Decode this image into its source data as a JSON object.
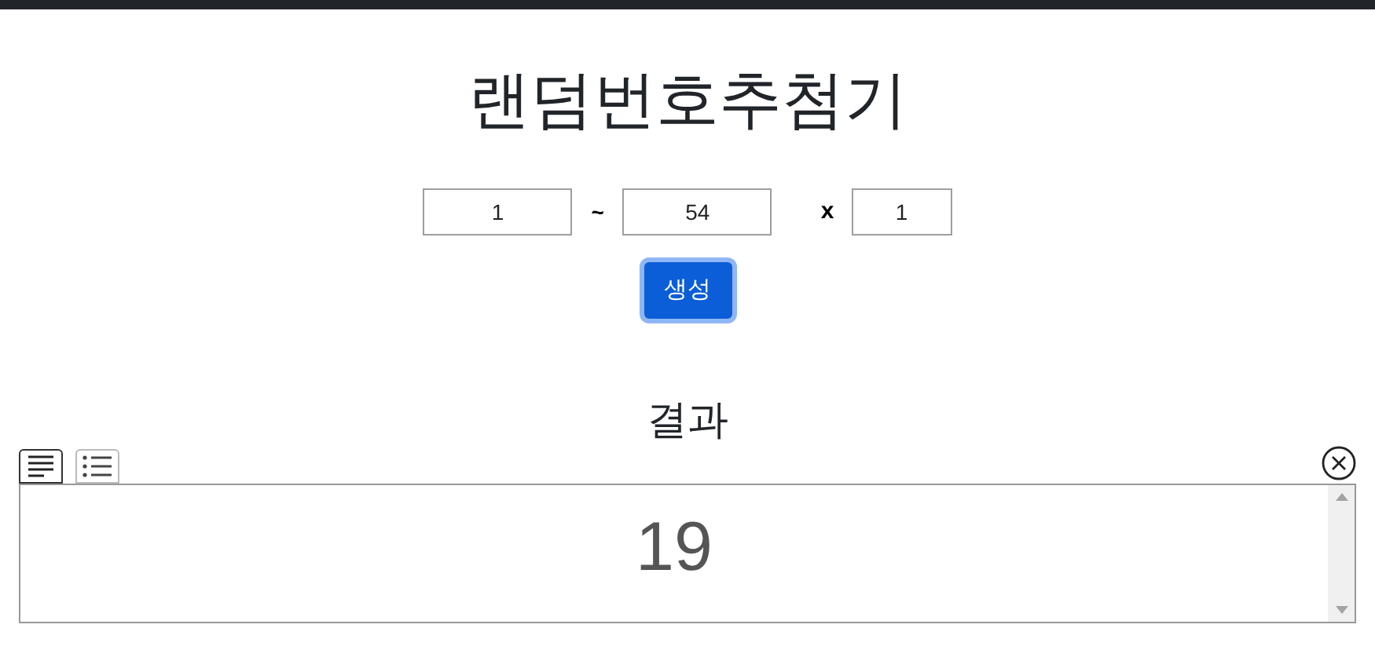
{
  "title": "랜덤번호추첨기",
  "range": {
    "min": "1",
    "separator": "~",
    "max": "54",
    "times_label": "x",
    "count": "1"
  },
  "generate_button": "생성",
  "result": {
    "heading": "결과",
    "view_modes": [
      {
        "kind": "text",
        "selected": true
      },
      {
        "kind": "list",
        "selected": false
      }
    ],
    "value": "19"
  }
}
